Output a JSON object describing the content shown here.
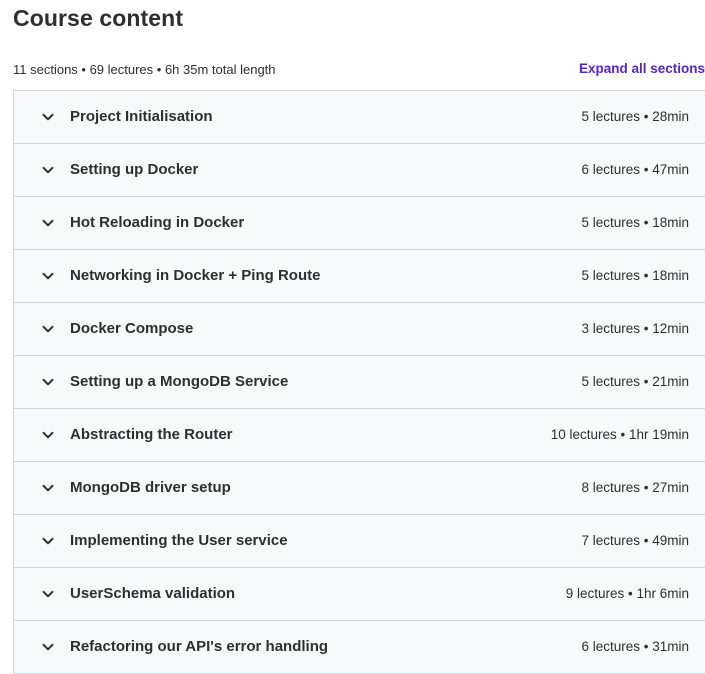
{
  "header": {
    "title": "Course content",
    "summary": "11 sections • 69 lectures • 6h 35m total length",
    "expand_label": "Expand all sections"
  },
  "sections": [
    {
      "title": "Project Initialisation",
      "meta": "5 lectures • 28min"
    },
    {
      "title": "Setting up Docker",
      "meta": "6 lectures • 47min"
    },
    {
      "title": "Hot Reloading in Docker",
      "meta": "5 lectures • 18min"
    },
    {
      "title": "Networking in Docker + Ping Route",
      "meta": "5 lectures • 18min"
    },
    {
      "title": "Docker Compose",
      "meta": "3 lectures • 12min"
    },
    {
      "title": "Setting up a MongoDB Service",
      "meta": "5 lectures • 21min"
    },
    {
      "title": "Abstracting the Router",
      "meta": "10 lectures • 1hr 19min"
    },
    {
      "title": "MongoDB driver setup",
      "meta": "8 lectures • 27min"
    },
    {
      "title": "Implementing the User service",
      "meta": "7 lectures • 49min"
    },
    {
      "title": "UserSchema validation",
      "meta": "9 lectures • 1hr 6min"
    },
    {
      "title": "Refactoring our API's error handling",
      "meta": "6 lectures • 31min"
    }
  ],
  "icons": {
    "section_toggle": "chevron-down-icon"
  },
  "colors": {
    "accent": "#5624d0",
    "text": "#2d2f31",
    "row_background": "#f7f9fa",
    "border": "#d1d7dc"
  }
}
